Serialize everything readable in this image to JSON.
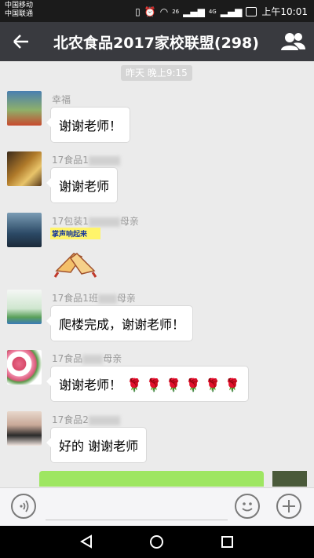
{
  "status_bar": {
    "carrier1": "中国移动",
    "carrier2": "中国联通",
    "network": "26",
    "network2": "4G",
    "time": "上午10:01"
  },
  "header": {
    "title": "北农食品2017家校联盟(298)",
    "back_icon": "back-arrow-icon",
    "group_icon": "group-members-icon"
  },
  "chat": {
    "timestamp": "昨天 晚上9:15",
    "messages": [
      {
        "sender": "幸福",
        "text": "谢谢老师！"
      },
      {
        "sender": "17食品1",
        "text": "谢谢老师"
      },
      {
        "sender_prefix": "17包装1",
        "sender_suffix": "母亲",
        "sticker_text": "掌声响起来"
      },
      {
        "sender_prefix": "17食品1班",
        "sender_suffix": "母亲",
        "text": "爬楼完成，谢谢老师！"
      },
      {
        "sender_prefix": "17食品",
        "sender_suffix": "母亲",
        "text": "谢谢老师！",
        "roses": "🌹 🌹 🌹 🌹 🌹 🌹"
      },
      {
        "sender": "17食品2",
        "text": "好的 谢谢老师"
      }
    ]
  },
  "colors": {
    "header_bg": "#393a3f",
    "chat_bg": "#ebebeb",
    "self_bubble": "#9ee662"
  }
}
